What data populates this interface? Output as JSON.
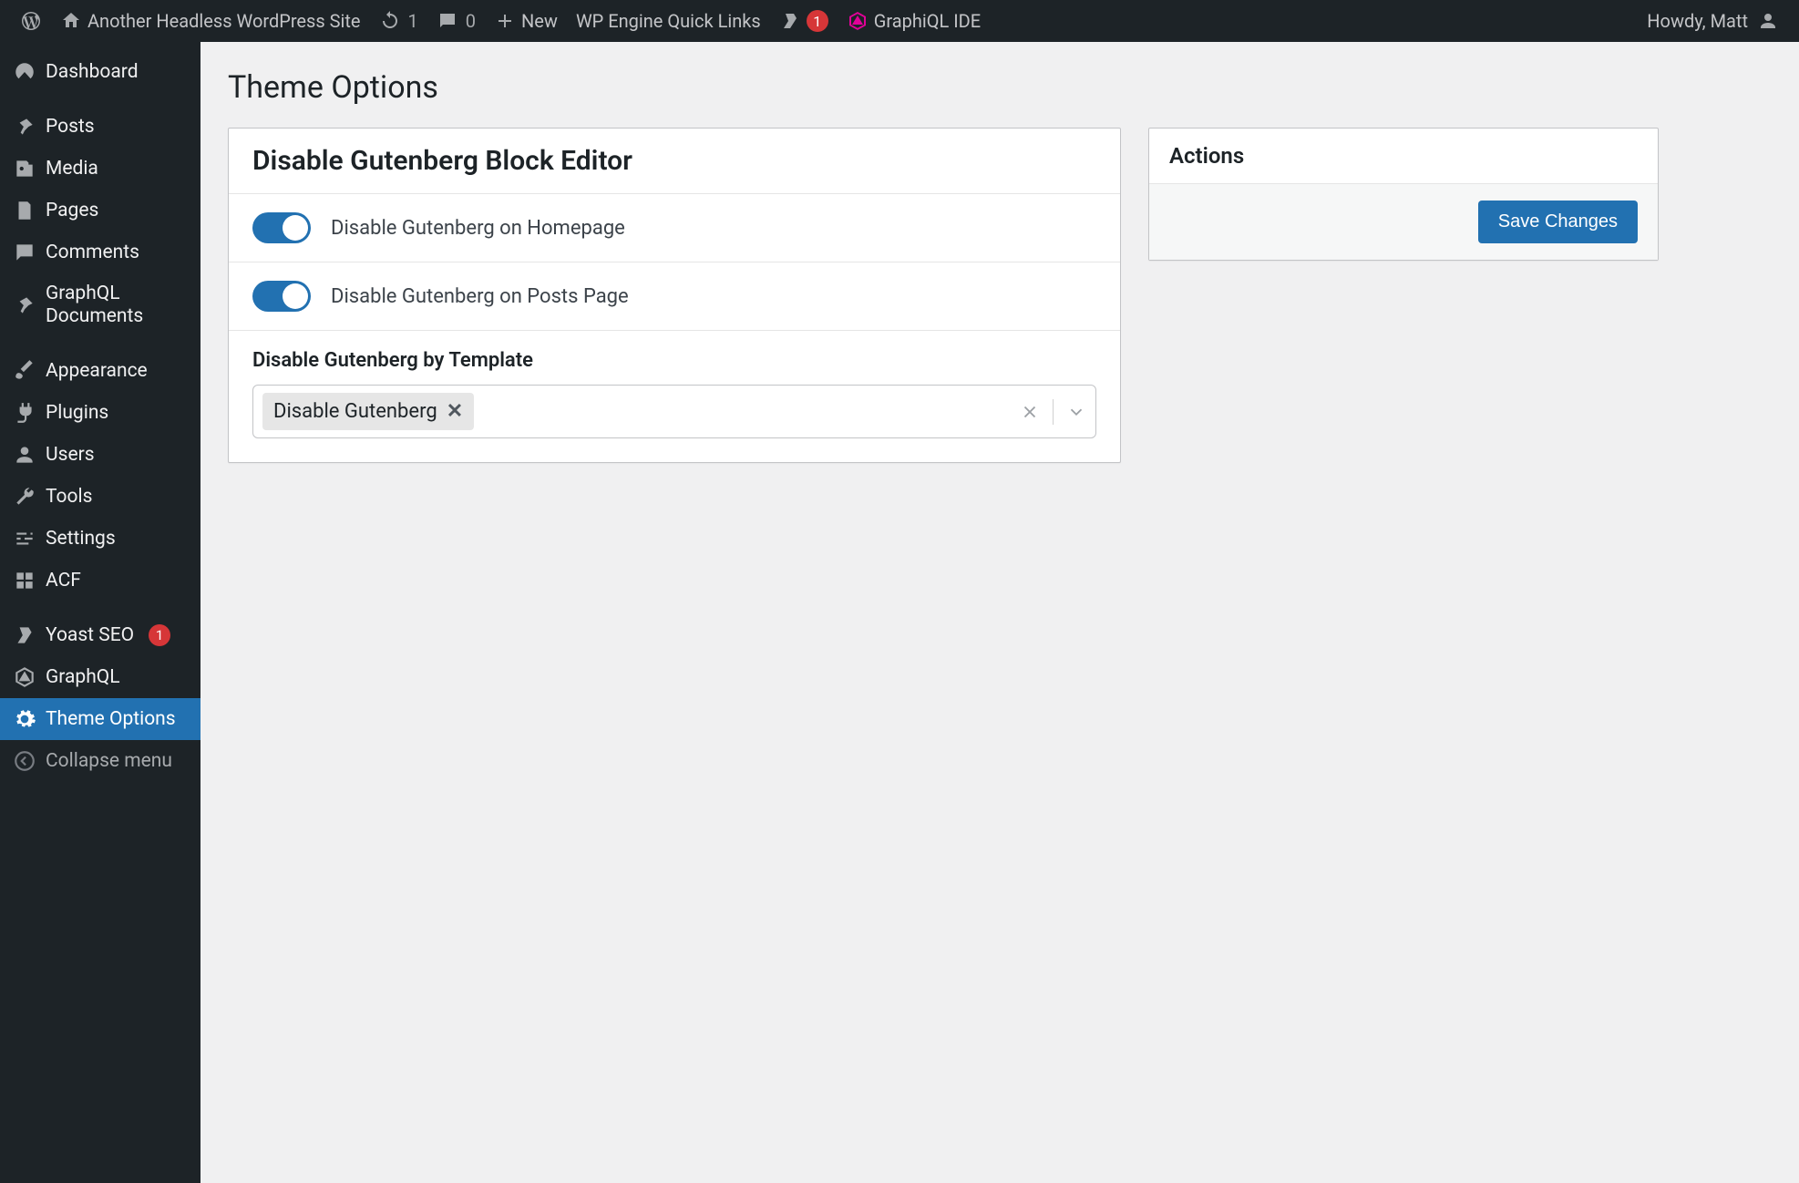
{
  "adminbar": {
    "site_title": "Another Headless WordPress Site",
    "updates_count": "1",
    "comments_count": "0",
    "new_label": "New",
    "quick_links_label": "WP Engine Quick Links",
    "yoast_badge": "1",
    "graphiql_label": "GraphiQL IDE",
    "greeting": "Howdy, Matt"
  },
  "sidebar": {
    "items": [
      {
        "label": "Dashboard"
      },
      {
        "label": "Posts"
      },
      {
        "label": "Media"
      },
      {
        "label": "Pages"
      },
      {
        "label": "Comments"
      },
      {
        "label": "GraphQL Documents"
      },
      {
        "label": "Appearance"
      },
      {
        "label": "Plugins"
      },
      {
        "label": "Users"
      },
      {
        "label": "Tools"
      },
      {
        "label": "Settings"
      },
      {
        "label": "ACF"
      },
      {
        "label": "Yoast SEO",
        "badge": "1"
      },
      {
        "label": "GraphQL"
      },
      {
        "label": "Theme Options"
      }
    ],
    "collapse_label": "Collapse menu"
  },
  "page": {
    "title": "Theme Options"
  },
  "panel": {
    "heading": "Disable Gutenberg Block Editor",
    "option1_label": "Disable Gutenberg on Homepage",
    "option2_label": "Disable Gutenberg on Posts Page",
    "template_section_label": "Disable Gutenberg by Template",
    "chip_label": "Disable Gutenberg"
  },
  "actions": {
    "heading": "Actions",
    "save_label": "Save Changes"
  }
}
